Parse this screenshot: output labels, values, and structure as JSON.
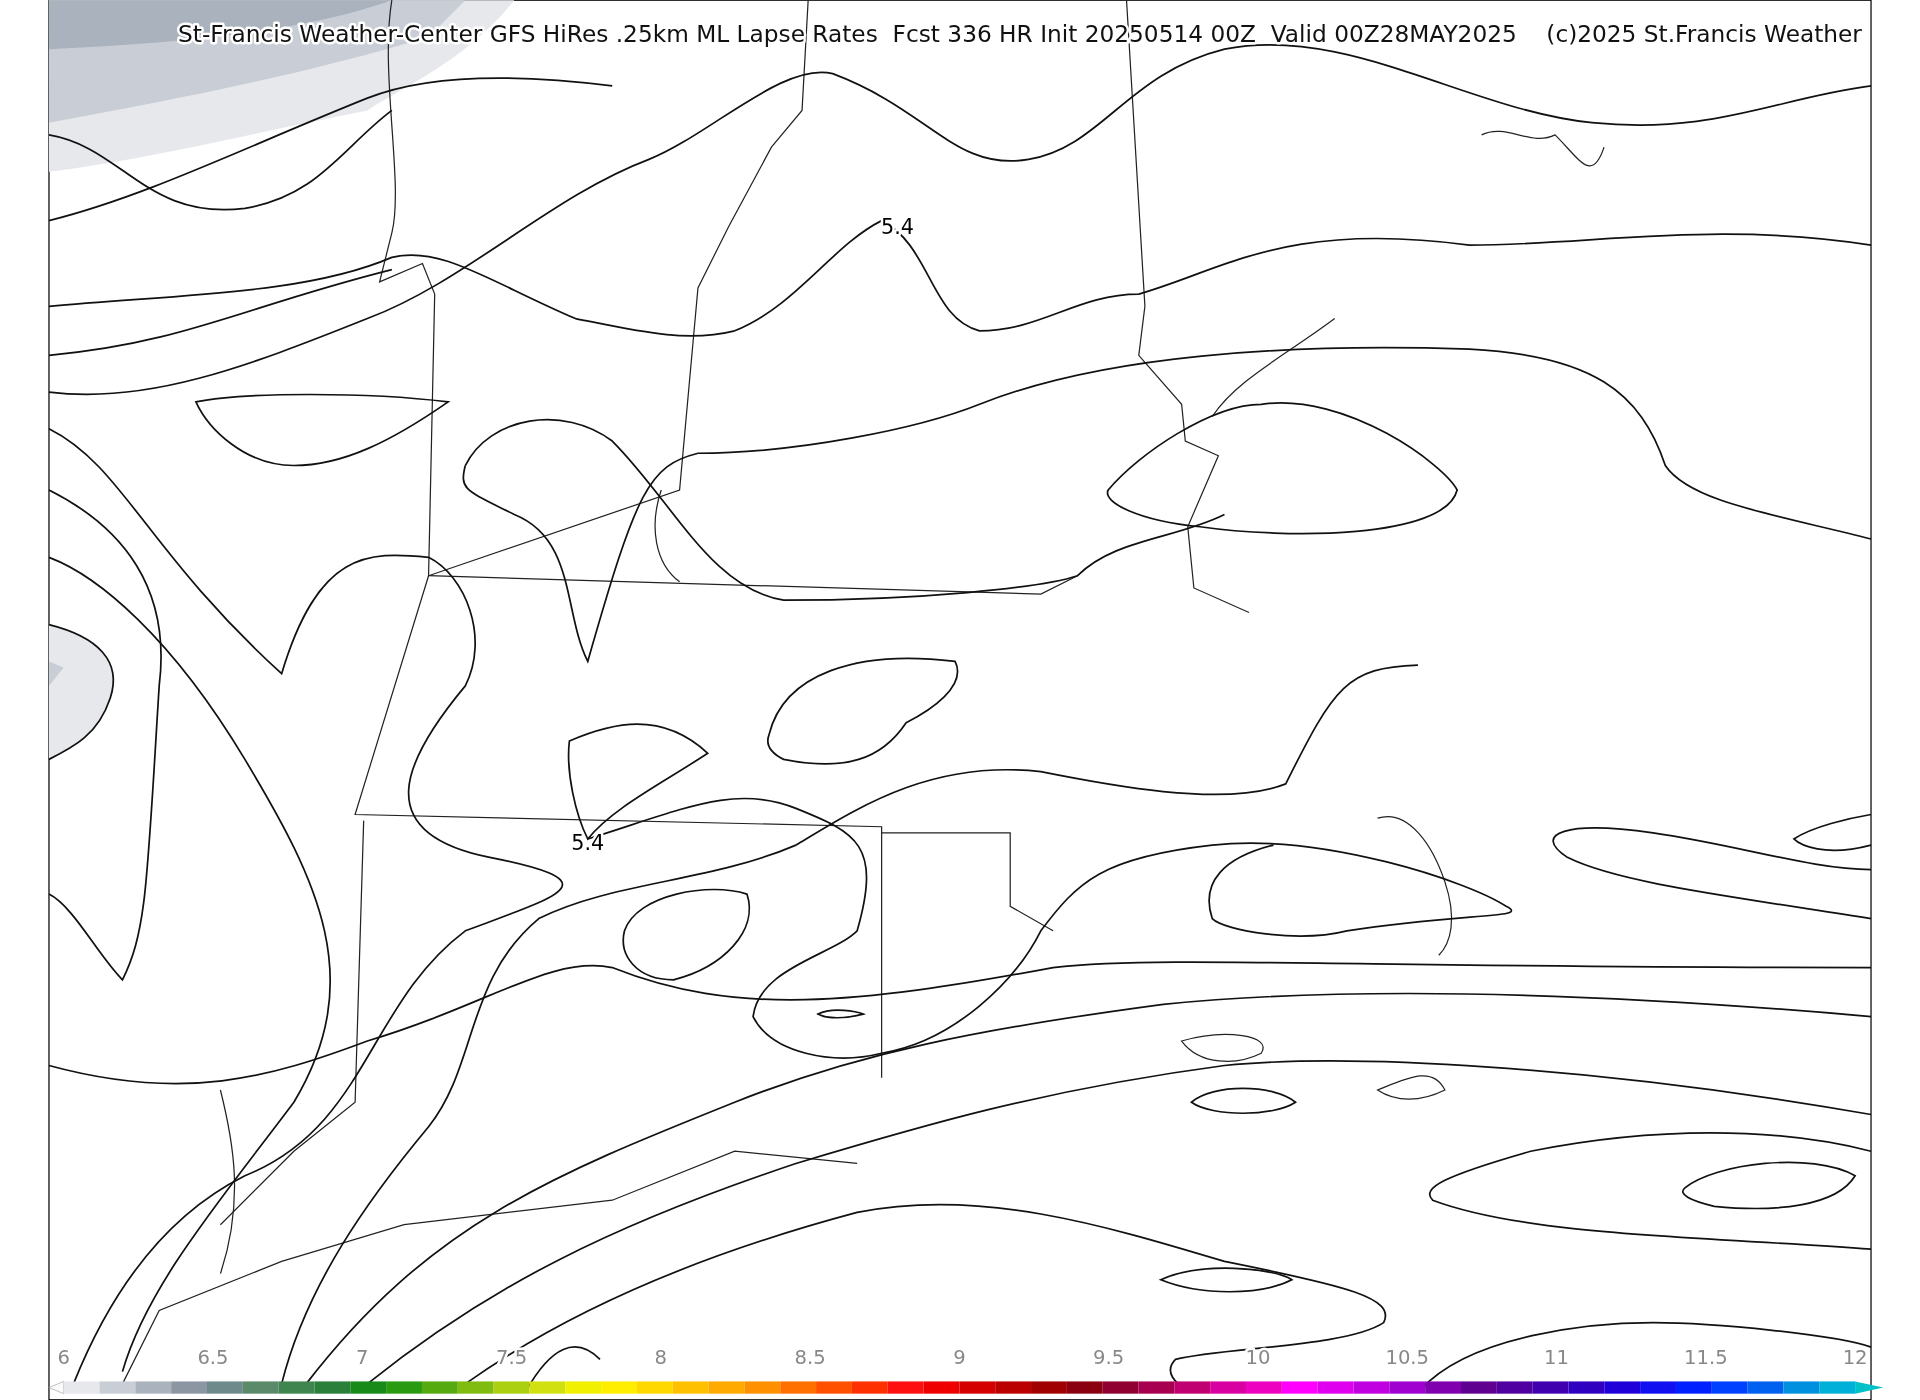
{
  "title": "St-Francis Weather-Center GFS HiRes .25km ML Lapse Rates  Fcst 336 HR Init 20250514 00Z  Valid 00Z28MAY2025    (c)2025 St.Francis Weather",
  "contour_labels": [
    "5.4",
    "5.4"
  ],
  "colorbar": {
    "ticks": [
      "6",
      "6.5",
      "7",
      "7.5",
      "8",
      "8.5",
      "9",
      "9.5",
      "10",
      "10.5",
      "11",
      "11.5",
      "12"
    ]
  }
}
